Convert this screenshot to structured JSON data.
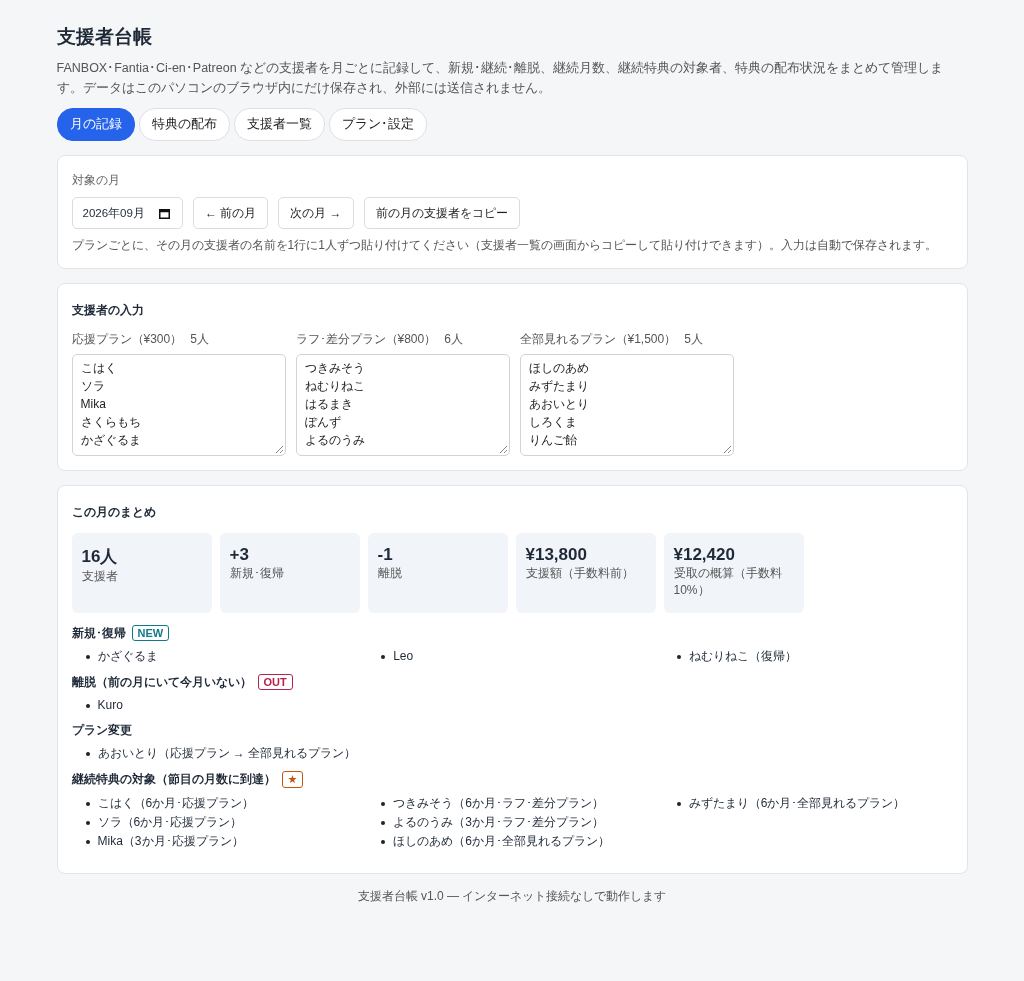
{
  "header": {
    "title": "支援者台帳",
    "description": "FANBOX･Fantia･Ci-en･Patreon などの支援者を月ごとに記録して、新規･継続･離脱、継続月数、継続特典の対象者、特典の配布状況をまとめて管理します。データはこのパソコンのブラウザ内にだけ保存され、外部には送信されません。"
  },
  "tabs": [
    {
      "label": "月の記録",
      "selected": true
    },
    {
      "label": "特典の配布",
      "selected": false
    },
    {
      "label": "支援者一覧",
      "selected": false
    },
    {
      "label": "プラン･設定",
      "selected": false
    }
  ],
  "month_panel": {
    "label": "対象の月",
    "month_value": "2026年09月",
    "buttons": [
      "← 前の月",
      "次の月 →",
      "前の月の支援者をコピー"
    ],
    "hint": "プランごとに、その月の支援者の名前を1行に1人ずつ貼り付けてください（支援者一覧の画面からコピーして貼り付けできます）。入力は自動で保存されます。"
  },
  "input_panel": {
    "title": "支援者の入力",
    "plans": [
      {
        "name": "応援プラン（¥300）",
        "count": "5人",
        "names": [
          "こはく",
          "ソラ",
          "Mika",
          "さくらもち",
          "かざぐるま"
        ]
      },
      {
        "name": "ラフ･差分プラン（¥800）",
        "count": "6人",
        "names": [
          "つきみそう",
          "ねむりねこ",
          "はるまき",
          "ぽんず",
          "よるのうみ"
        ]
      },
      {
        "name": "全部見れるプラン（¥1,500）",
        "count": "5人",
        "names": [
          "ほしのあめ",
          "みずたまり",
          "あおいとり",
          "しろくま",
          "りんご飴"
        ]
      }
    ]
  },
  "summary_panel": {
    "title": "この月のまとめ",
    "stats": [
      {
        "value": "16人",
        "label": "支援者"
      },
      {
        "value": "+3",
        "label": "新規･復帰"
      },
      {
        "value": "-1",
        "label": "離脱"
      },
      {
        "value": "¥13,800",
        "label": "支援額（手数料前）"
      },
      {
        "value": "¥12,420",
        "label": "受取の概算（手数料10%）"
      }
    ],
    "sections": [
      {
        "heading": "新規･復帰",
        "badge": {
          "text": "NEW",
          "kind": "new"
        },
        "items": [
          "かざぐるま",
          "Leo",
          "ねむりねこ（復帰）"
        ]
      },
      {
        "heading": "離脱（前の月にいて今月いない）",
        "badge": {
          "text": "OUT",
          "kind": "out"
        },
        "items": [
          "Kuro"
        ]
      },
      {
        "heading": "プラン変更",
        "items": [
          "あおいとり（応援プラン → 全部見れるプラン）"
        ]
      },
      {
        "heading": "継続特典の対象（節目の月数に到達）",
        "badge": {
          "text": "★",
          "kind": "star"
        },
        "items": [
          "こはく（6か月･応援プラン）",
          "ソラ（6か月･応援プラン）",
          "Mika（3か月･応援プラン）",
          "つきみそう（6か月･ラフ･差分プラン）",
          "よるのうみ（3か月･ラフ･差分プラン）",
          "ほしのあめ（6か月･全部見れるプラン）",
          "みずたまり（6か月･全部見れるプラン）"
        ]
      }
    ]
  },
  "footer": "支援者台帳 v1.0 — インターネット接続なしで動作します"
}
